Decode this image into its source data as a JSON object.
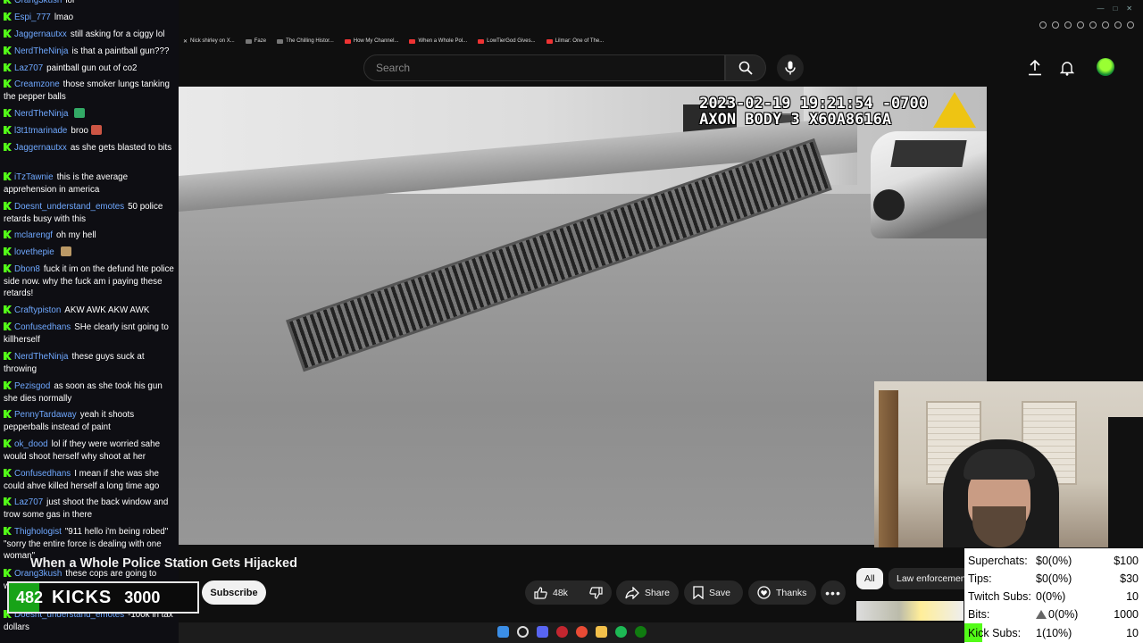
{
  "browser": {
    "bookmarks": [
      {
        "label": "Nick shirley on X...",
        "kind": "x"
      },
      {
        "label": "Faze",
        "kind": "folder"
      },
      {
        "label": "The Chilling Histor...",
        "kind": "folder"
      },
      {
        "label": "How My Channel...",
        "kind": "yt"
      },
      {
        "label": "When a Whole Pol...",
        "kind": "yt"
      },
      {
        "label": "LowTierGod Gives...",
        "kind": "yt"
      },
      {
        "label": "Lilmar: One of The...",
        "kind": "yt"
      }
    ]
  },
  "youtube": {
    "search_placeholder": "Search",
    "video_title": "When a Whole Police Station Gets Hijacked",
    "subscribe_label": "Subscribe",
    "like_count": "48k",
    "share_label": "Share",
    "save_label": "Save",
    "thanks_label": "Thanks",
    "chips": [
      "All",
      "Law enforcemen"
    ]
  },
  "video_overlay": {
    "timestamp": "2023-02-19 19:21:54 -0700",
    "device": "AXON BODY 3 X60A8616A"
  },
  "stats": {
    "rows": [
      {
        "label": "Superchats:",
        "value": "$0(0%)",
        "goal": "$100"
      },
      {
        "label": "Tips:",
        "value": "$0(0%)",
        "goal": "$30"
      },
      {
        "label": "Twitch Subs:",
        "value": "0(0%)",
        "goal": "10"
      },
      {
        "label": "Bits:",
        "value": "0(0%)",
        "goal": "1000"
      },
      {
        "label": "Kick Subs:",
        "value": "1(10%)",
        "goal": "10"
      }
    ]
  },
  "kicks": {
    "current": "482",
    "label": "KICKS",
    "goal": "3000",
    "progress": 0.16
  },
  "chat": {
    "messages": [
      {
        "user": "Orang3kush",
        "text": "lol"
      },
      {
        "user": "Espi_777",
        "text": "lmao"
      },
      {
        "user": "Jaggernautxx",
        "text": "still asking for a ciggy lol"
      },
      {
        "user": "NerdTheNinja",
        "text": "is that a paintball gun???"
      },
      {
        "user": "Laz707",
        "text": "paintball gun out of co2"
      },
      {
        "user": "Creamzone",
        "text": "those smoker lungs tanking the pepper balls"
      },
      {
        "user": "NerdTheNinja",
        "text": "",
        "emote": "#3a6"
      },
      {
        "user": "l3t1tmarinade",
        "text": "broo",
        "emote": "#c54"
      },
      {
        "user": "Jaggernautxx",
        "text": "as she gets blasted to bits"
      },
      {
        "user": "iTzTawnie",
        "text": "this is the average apprehension in america"
      },
      {
        "user": "Doesnt_understand_emotes",
        "text": "50 police retards busy with this"
      },
      {
        "user": "mclarengf",
        "text": "oh my hell"
      },
      {
        "user": "lovethepie",
        "text": "",
        "emote": "#b96"
      },
      {
        "user": "Dbon8",
        "text": "fuck it im on the defund hte police side now. why the fuck am i paying these retards!"
      },
      {
        "user": "Craftypiston",
        "text": "AKW AWK AKW AWK"
      },
      {
        "user": "Confusedhans",
        "text": "SHe clearly isnt going to killherself"
      },
      {
        "user": "NerdTheNinja",
        "text": "these guys suck at throwing"
      },
      {
        "user": "Pezisgod",
        "text": "as soon as she took his gun she dies normally"
      },
      {
        "user": "PennyTardaway",
        "text": "yeah it shoots pepperballs instead of paint"
      },
      {
        "user": "ok_dood",
        "text": "lol if they were worried sahe would shoot herself why shoot at her"
      },
      {
        "user": "Confusedhans",
        "text": "I mean if she was she could ahve killed herself a long time ago"
      },
      {
        "user": "Laz707",
        "text": "just shoot the back window and trow some gas in there"
      },
      {
        "user": "Thighologist",
        "text": "\"911 hello i'm being robed\" \"sorry the entire force is dealing with one woman\""
      },
      {
        "user": "Orang3kush",
        "text": "these cops are going to whip this bitch over this accident"
      },
      {
        "user": "Doesnt_understand_emotes",
        "text": "-100k in tax dollars"
      }
    ]
  }
}
